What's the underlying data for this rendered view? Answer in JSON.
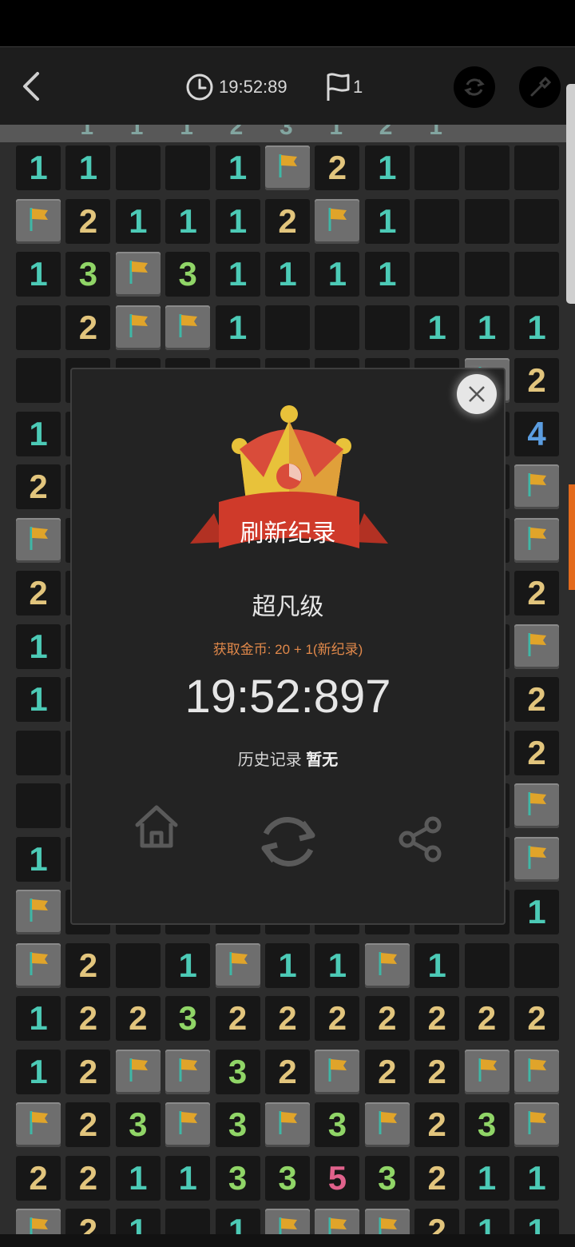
{
  "topbar": {
    "timer": "19:52:89",
    "flag_count": "1"
  },
  "strip_digits": [
    "1",
    "1",
    "1",
    "2",
    "3",
    "1",
    "2",
    "1"
  ],
  "board": {
    "rows": [
      [
        "1",
        "1",
        "",
        "",
        "1",
        "F",
        "2",
        "1",
        "",
        "",
        ""
      ],
      [
        "F",
        "2",
        "1",
        "1",
        "1",
        "2",
        "F",
        "1",
        "",
        "",
        ""
      ],
      [
        "1",
        "3",
        "F",
        "3",
        "1",
        "1",
        "1",
        "1",
        "",
        "",
        ""
      ],
      [
        "",
        "2",
        "F",
        "F",
        "1",
        "",
        "",
        "",
        "1",
        "1",
        "1"
      ],
      [
        "",
        "",
        "",
        "",
        "",
        "",
        "",
        "",
        "",
        "F",
        "2"
      ],
      [
        "1",
        "",
        "",
        "",
        "",
        "",
        "",
        "",
        "",
        "",
        "4"
      ],
      [
        "2",
        "",
        "",
        "",
        "",
        "",
        "",
        "",
        "",
        "",
        "F"
      ],
      [
        "F",
        "",
        "",
        "",
        "",
        "",
        "",
        "",
        "",
        "",
        "F"
      ],
      [
        "2",
        "",
        "",
        "",
        "",
        "",
        "",
        "",
        "",
        "",
        "2"
      ],
      [
        "1",
        "",
        "",
        "",
        "",
        "",
        "",
        "",
        "",
        "",
        "F"
      ],
      [
        "1",
        "",
        "",
        "",
        "",
        "",
        "",
        "",
        "",
        "",
        "2"
      ],
      [
        "",
        "",
        "",
        "",
        "",
        "",
        "",
        "",
        "",
        "",
        "2"
      ],
      [
        "",
        "",
        "",
        "",
        "",
        "",
        "",
        "",
        "",
        "",
        "F"
      ],
      [
        "1",
        "",
        "",
        "",
        "",
        "",
        "",
        "",
        "",
        "",
        "F"
      ],
      [
        "F",
        "",
        "",
        "",
        "",
        "",
        "",
        "",
        "",
        "",
        "1"
      ],
      [
        "F",
        "2",
        "",
        "1",
        "F",
        "1",
        "1",
        "F",
        "1",
        "",
        ""
      ],
      [
        "1",
        "2",
        "2",
        "3",
        "2",
        "2",
        "2",
        "2",
        "2",
        "2",
        "2"
      ],
      [
        "1",
        "2",
        "F",
        "F",
        "3",
        "2",
        "F",
        "2",
        "2",
        "F",
        "F"
      ],
      [
        "F",
        "2",
        "3",
        "F",
        "3",
        "F",
        "3",
        "F",
        "2",
        "3",
        "F"
      ],
      [
        "2",
        "2",
        "1",
        "1",
        "3",
        "3",
        "5",
        "3",
        "2",
        "1",
        "1"
      ],
      [
        "F",
        "2",
        "1",
        "",
        "1",
        "F",
        "F",
        "F",
        "2",
        "1",
        "1"
      ]
    ]
  },
  "dialog": {
    "record_label": "刷新纪录",
    "level": "超凡级",
    "coins": "获取金币: 20 + 1(新纪录)",
    "time": "19:52:897",
    "history_label": "历史记录",
    "history_value": "暂无",
    "icons": [
      "home-icon",
      "restart-icon",
      "share-icon"
    ]
  },
  "colors": {
    "n1": "#4ccab6",
    "n2": "#e2c57d",
    "n3": "#90d567",
    "n4": "#5b9de0",
    "n5": "#e0628c",
    "accent": "#e36a1c",
    "ribbon": "#cf3a2a"
  }
}
